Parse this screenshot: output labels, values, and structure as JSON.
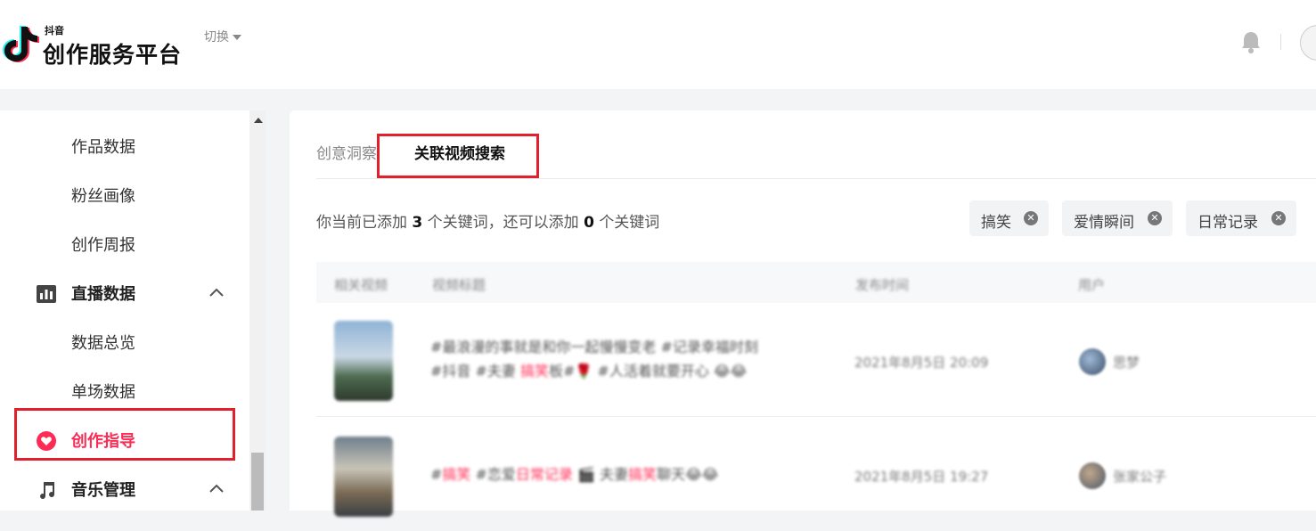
{
  "header": {
    "logo_small": "抖音",
    "logo_big": "创作服务平台",
    "switch_label": "切换"
  },
  "sidebar": {
    "items": [
      {
        "label": "作品数据",
        "type": "sub"
      },
      {
        "label": "粉丝画像",
        "type": "sub"
      },
      {
        "label": "创作周报",
        "type": "sub"
      },
      {
        "label": "直播数据",
        "type": "section",
        "icon": "bar-chart-icon",
        "expanded": true
      },
      {
        "label": "数据总览",
        "type": "sub"
      },
      {
        "label": "单场数据",
        "type": "sub"
      },
      {
        "label": "创作指导",
        "type": "section",
        "icon": "heart-icon",
        "active": true
      },
      {
        "label": "音乐管理",
        "type": "section",
        "icon": "music-note-icon",
        "expanded": true
      }
    ]
  },
  "main": {
    "tabs": [
      {
        "label": "创意洞察"
      },
      {
        "label": "关联视频搜索",
        "active": true
      }
    ],
    "keyword_text": {
      "prefix": "你当前已添加",
      "added": "3",
      "middle": "个关键词，还可以添加",
      "remaining": "0",
      "suffix": "个关键词"
    },
    "chips": [
      "搞笑",
      "爱情瞬间",
      "日常记录"
    ],
    "table": {
      "headers": [
        "相关视频",
        "视频标题",
        "发布时间",
        "用户"
      ],
      "rows": [
        {
          "title_line1": "#最浪漫的事就是和你一起慢慢变老 #记录幸福时刻",
          "title_line2_a": "#抖音 #夫妻 ",
          "title_line2_hl": "搞笑",
          "title_line2_b": "板#🌹 #人活着就要开心 😂😂",
          "time": "2021年8月5日 20:09",
          "user": "思梦"
        },
        {
          "title_line1_a": "#",
          "title_line1_hl1": "搞笑",
          "title_line1_b": " #恋爱",
          "title_line1_hl2": "日常记录",
          "title_line1_c": " 🎬 夫妻",
          "title_line1_hl3": "搞笑",
          "title_line1_d": "聊天😂😂",
          "time": "2021年8月5日 19:27",
          "user": "张家公子"
        }
      ]
    }
  },
  "colors": {
    "accent": "#fe2c55",
    "highlight_box": "#e0202d"
  }
}
